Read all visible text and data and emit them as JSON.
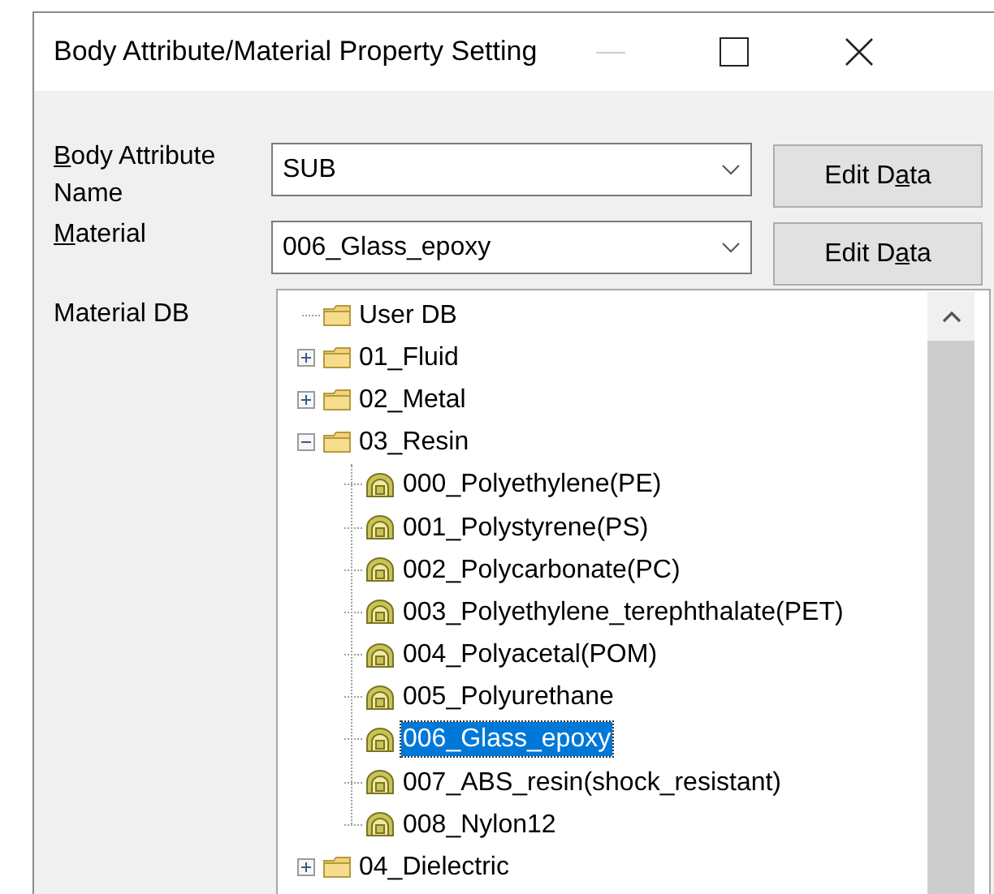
{
  "window": {
    "title": "Body Attribute/Material Property Setting"
  },
  "fields": [
    {
      "label": {
        "mnemonic": "B",
        "after": "ody Attribute Name"
      },
      "value": "SUB",
      "button": {
        "before": "Edit D",
        "mnemonic": "a",
        "after": "ta"
      }
    },
    {
      "label": {
        "mnemonic": "M",
        "after": "aterial"
      },
      "value": "006_Glass_epoxy",
      "button": {
        "before": "Edit D",
        "mnemonic": "a",
        "after": "ta"
      }
    }
  ],
  "material_db": {
    "label": "Material DB",
    "tree": [
      {
        "kind": "folder",
        "label": "User DB",
        "selected": false
      },
      {
        "kind": "folder",
        "label": "01_Fluid",
        "expanded": false,
        "selected": false
      },
      {
        "kind": "folder",
        "label": "02_Metal",
        "expanded": false,
        "selected": false
      },
      {
        "kind": "folder",
        "label": "03_Resin",
        "expanded": true,
        "selected": false,
        "children": [
          {
            "kind": "material",
            "label": "000_Polyethylene(PE)",
            "selected": false
          },
          {
            "kind": "material",
            "label": "001_Polystyrene(PS)",
            "selected": false
          },
          {
            "kind": "material",
            "label": "002_Polycarbonate(PC)",
            "selected": false
          },
          {
            "kind": "material",
            "label": "003_Polyethylene_terephthalate(PET)",
            "selected": false
          },
          {
            "kind": "material",
            "label": "004_Polyacetal(POM)",
            "selected": false
          },
          {
            "kind": "material",
            "label": "005_Polyurethane",
            "selected": false
          },
          {
            "kind": "material",
            "label": "006_Glass_epoxy",
            "selected": true
          },
          {
            "kind": "material",
            "label": "007_ABS_resin(shock_resistant)",
            "selected": false
          },
          {
            "kind": "material",
            "label": "008_Nylon12",
            "selected": false
          }
        ]
      },
      {
        "kind": "folder",
        "label": "04_Dielectric",
        "expanded": false,
        "selected": false
      }
    ]
  }
}
